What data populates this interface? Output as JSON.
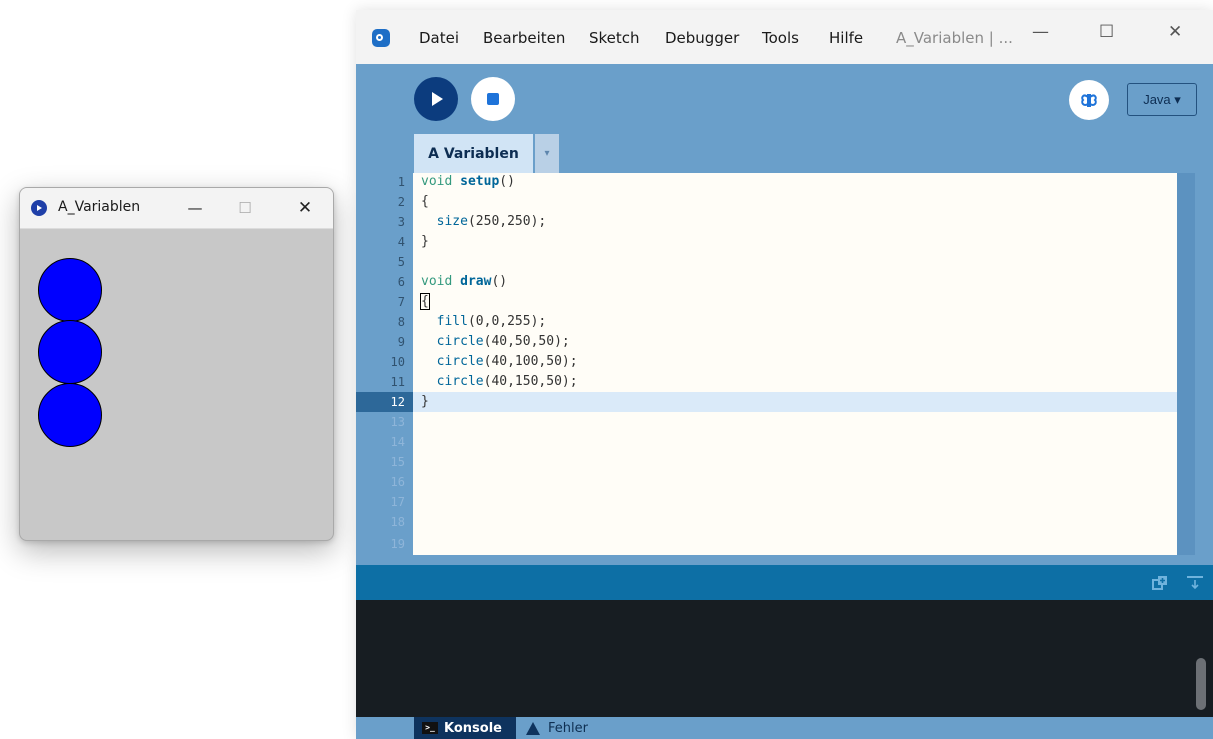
{
  "sketch_window": {
    "title": "A_Variablen",
    "controls": {
      "minimize": "—",
      "maximize": "☐",
      "close": "✕"
    },
    "canvas": {
      "background": "#c8c8c8",
      "fill_color": "#0000ff",
      "stroke_color": "#000000"
    }
  },
  "ide": {
    "menu": [
      "Datei",
      "Bearbeiten",
      "Sketch",
      "Debugger",
      "Tools",
      "Hilfe"
    ],
    "window_title": "A_Variablen | ...",
    "controls": {
      "minimize": "—",
      "maximize": "☐",
      "close": "✕"
    },
    "toolbar": {
      "mode": "Java ▾",
      "debug_icon": "butterfly-icon"
    },
    "tab": {
      "label": "A Variablen",
      "menu_glyph": "▾"
    },
    "editor": {
      "line_numbers": [
        "1",
        "2",
        "3",
        "4",
        "5",
        "6",
        "7",
        "8",
        "9",
        "10",
        "11",
        "12",
        "13",
        "14",
        "15",
        "16",
        "17",
        "18",
        "19"
      ],
      "current_line": "12"
    },
    "console_tabs": {
      "console": "Konsole",
      "errors": "Fehler"
    }
  },
  "code": {
    "l1_kw": "void",
    "l1_fn": "setup",
    "l1_rest": "()",
    "l2": "{",
    "l3_call": "size",
    "l3_rest": "(250,250);",
    "l4": "}",
    "l6_kw": "void",
    "l6_fn": "draw",
    "l6_rest": "()",
    "l7": "{",
    "l8_call": "fill",
    "l8_rest": "(0,0,255);",
    "l9_call": "circle",
    "l9_rest": "(40,50,50);",
    "l10_call": "circle",
    "l10_rest": "(40,100,50);",
    "l11_call": "circle",
    "l11_rest": "(40,150,50);",
    "l12": "}"
  },
  "colors": {
    "ide_background": "#6a9fca",
    "run_button": "#0c3c7e",
    "console_header": "#0d6fa5",
    "console": "#171d22"
  }
}
